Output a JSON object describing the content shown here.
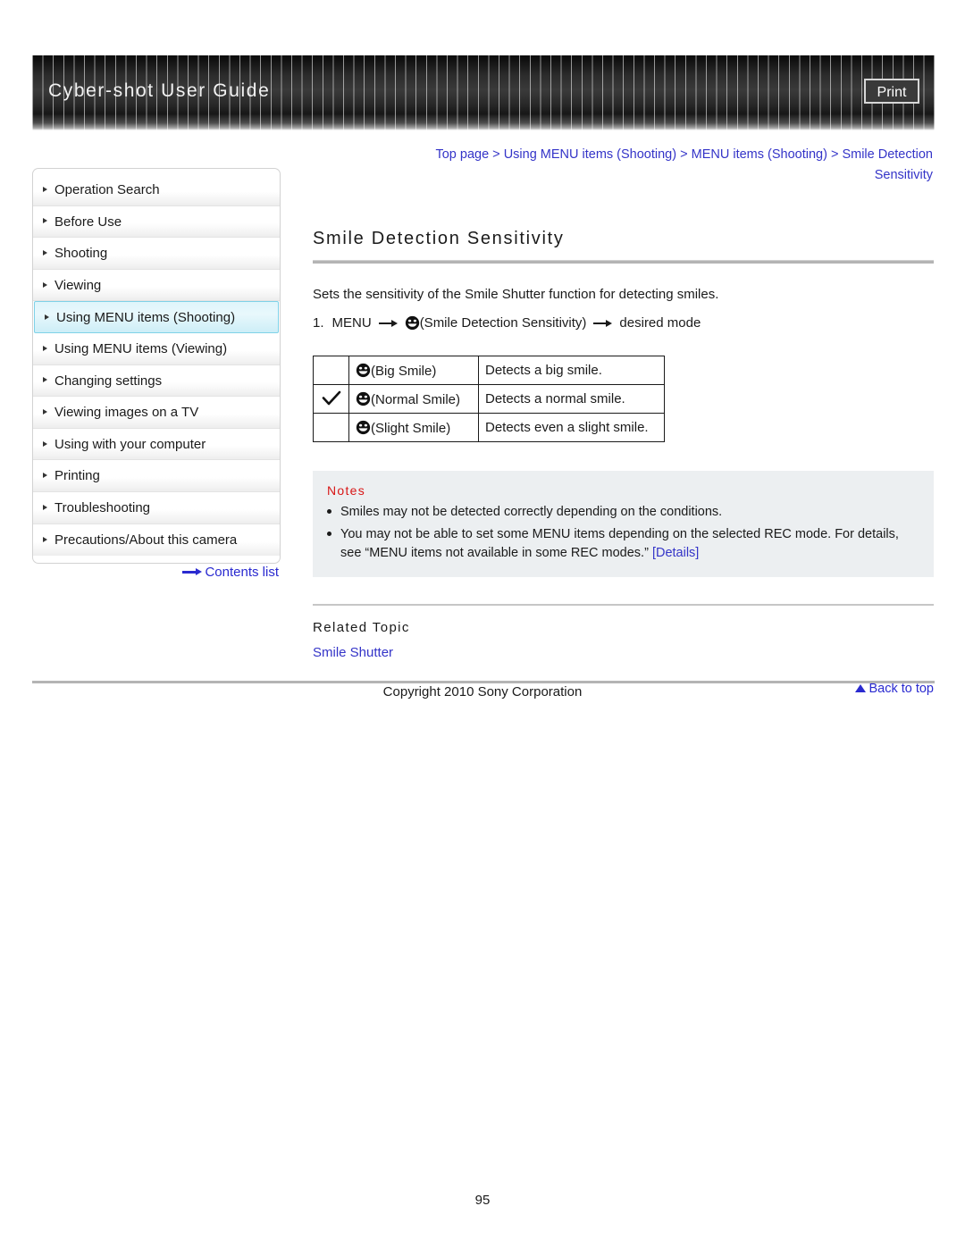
{
  "header": {
    "title": "Cyber-shot User Guide",
    "print_label": "Print"
  },
  "sidebar": {
    "items": [
      {
        "label": "Operation Search",
        "active": false
      },
      {
        "label": "Before Use",
        "active": false
      },
      {
        "label": "Shooting",
        "active": false
      },
      {
        "label": "Viewing",
        "active": false
      },
      {
        "label": "Using MENU items (Shooting)",
        "active": true
      },
      {
        "label": "Using MENU items (Viewing)",
        "active": false
      },
      {
        "label": "Changing settings",
        "active": false
      },
      {
        "label": "Viewing images on a TV",
        "active": false
      },
      {
        "label": "Using with your computer",
        "active": false
      },
      {
        "label": "Printing",
        "active": false
      },
      {
        "label": "Troubleshooting",
        "active": false
      },
      {
        "label": "Precautions/About this camera",
        "active": false
      }
    ],
    "contents_link": "Contents list"
  },
  "breadcrumb": {
    "line1_part1": "Top page",
    "sep": " > ",
    "line1_part2": "Using MENU items (Shooting)",
    "line1_part3": "MENU items (Shooting)",
    "line1_part4": "Smile Detection",
    "line2": "Sensitivity",
    "full": "Top page > Using MENU items (Shooting) > MENU items (Shooting) > Smile Detection Sensitivity"
  },
  "main": {
    "page_title": "Smile Detection Sensitivity",
    "intro": "Sets the sensitivity of the Smile Shutter function for detecting smiles.",
    "step": {
      "number": "1.",
      "menu_label": "MENU",
      "smiley_icon": "smiley-icon",
      "paren_label": "(Smile Detection Sensitivity)",
      "tail_label": "desired mode"
    },
    "table": {
      "rows": [
        {
          "checked": "",
          "icon": "smiley-icon",
          "label": "(Big Smile)",
          "description": "Detects a big smile."
        },
        {
          "checked": "check-icon",
          "icon": "smiley-icon",
          "label": "(Normal Smile)",
          "description": "Detects a normal smile."
        },
        {
          "checked": "",
          "icon": "smiley-icon",
          "label": "(Slight Smile)",
          "description": "Detects even a slight smile."
        }
      ]
    },
    "notes": {
      "title": "Notes",
      "items": [
        {
          "text": "Smiles may not be detected correctly depending on the conditions.",
          "link": ""
        },
        {
          "text": "You may not be able to set some MENU items depending on the selected REC mode. For details, see “MENU items not available in some REC modes.” ",
          "link": "[Details]"
        }
      ]
    },
    "related": {
      "title": "Related Topic",
      "link": "Smile Shutter"
    },
    "back_to_top": "Back to top"
  },
  "footer": {
    "copyright": "Copyright 2010 Sony Corporation",
    "page_number": "95"
  },
  "colors": {
    "link": "#3434c8",
    "notes_title": "#d81616",
    "active_nav_border": "#7fd2e8",
    "rule": "#b4b4b4"
  }
}
